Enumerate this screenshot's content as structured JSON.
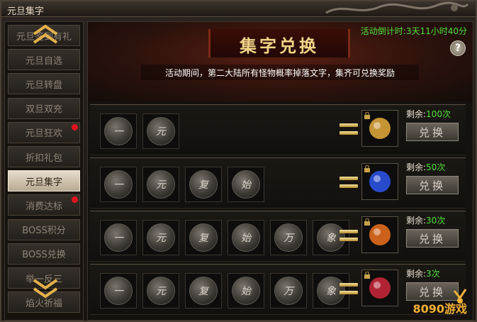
{
  "window": {
    "title": "元旦集字"
  },
  "sidebar": {
    "items": [
      {
        "label": "元旦签到有礼",
        "active": false,
        "dot": false
      },
      {
        "label": "元旦自选",
        "active": false,
        "dot": false
      },
      {
        "label": "元旦转盘",
        "active": false,
        "dot": false
      },
      {
        "label": "双旦双充",
        "active": false,
        "dot": false
      },
      {
        "label": "元旦狂欢",
        "active": false,
        "dot": true
      },
      {
        "label": "折扣礼包",
        "active": false,
        "dot": false
      },
      {
        "label": "元旦集字",
        "active": true,
        "dot": false
      },
      {
        "label": "消费达标",
        "active": false,
        "dot": true
      },
      {
        "label": "BOSS积分",
        "active": false,
        "dot": false
      },
      {
        "label": "BOSS兑换",
        "active": false,
        "dot": false
      },
      {
        "label": "举一反三",
        "active": false,
        "dot": false
      },
      {
        "label": "焰火祈福",
        "active": false,
        "dot": false
      }
    ],
    "scroll_up_icon": "double-chevron-up-icon",
    "scroll_down_icon": "double-chevron-down-icon"
  },
  "main": {
    "banner_title": "集字兑换",
    "countdown": "活动倒计时:3天11小时40分",
    "help_label": "?",
    "description": "活动期间，第二大陆所有怪物概率掉落文字，集齐可兑换奖励",
    "remain_prefix": "剩余:",
    "exchange_label": "兑换",
    "rows": [
      {
        "chars": [
          "一",
          "元"
        ],
        "remain": "100次",
        "reward_icon": "golden-ornament-icon",
        "reward_color": "#d9a33a"
      },
      {
        "chars": [
          "一",
          "元",
          "复",
          "始"
        ],
        "remain": "50次",
        "reward_icon": "blue-orb-icon",
        "reward_color": "#2b52e0"
      },
      {
        "chars": [
          "一",
          "元",
          "复",
          "始",
          "万",
          "象"
        ],
        "remain": "30次",
        "reward_icon": "fire-orb-icon",
        "reward_color": "#e06a1c"
      },
      {
        "chars": [
          "一",
          "元",
          "复",
          "始",
          "万",
          "象"
        ],
        "remain": "3次",
        "reward_icon": "crimson-crystal-icon",
        "reward_color": "#c4253a"
      }
    ]
  },
  "watermark": {
    "text": "8090游戏",
    "icon": "cheering-figure-logo-icon"
  },
  "colors": {
    "accent_green": "#4ee13a",
    "title_gold": "#f1d487",
    "alert_red": "#e1141b"
  }
}
